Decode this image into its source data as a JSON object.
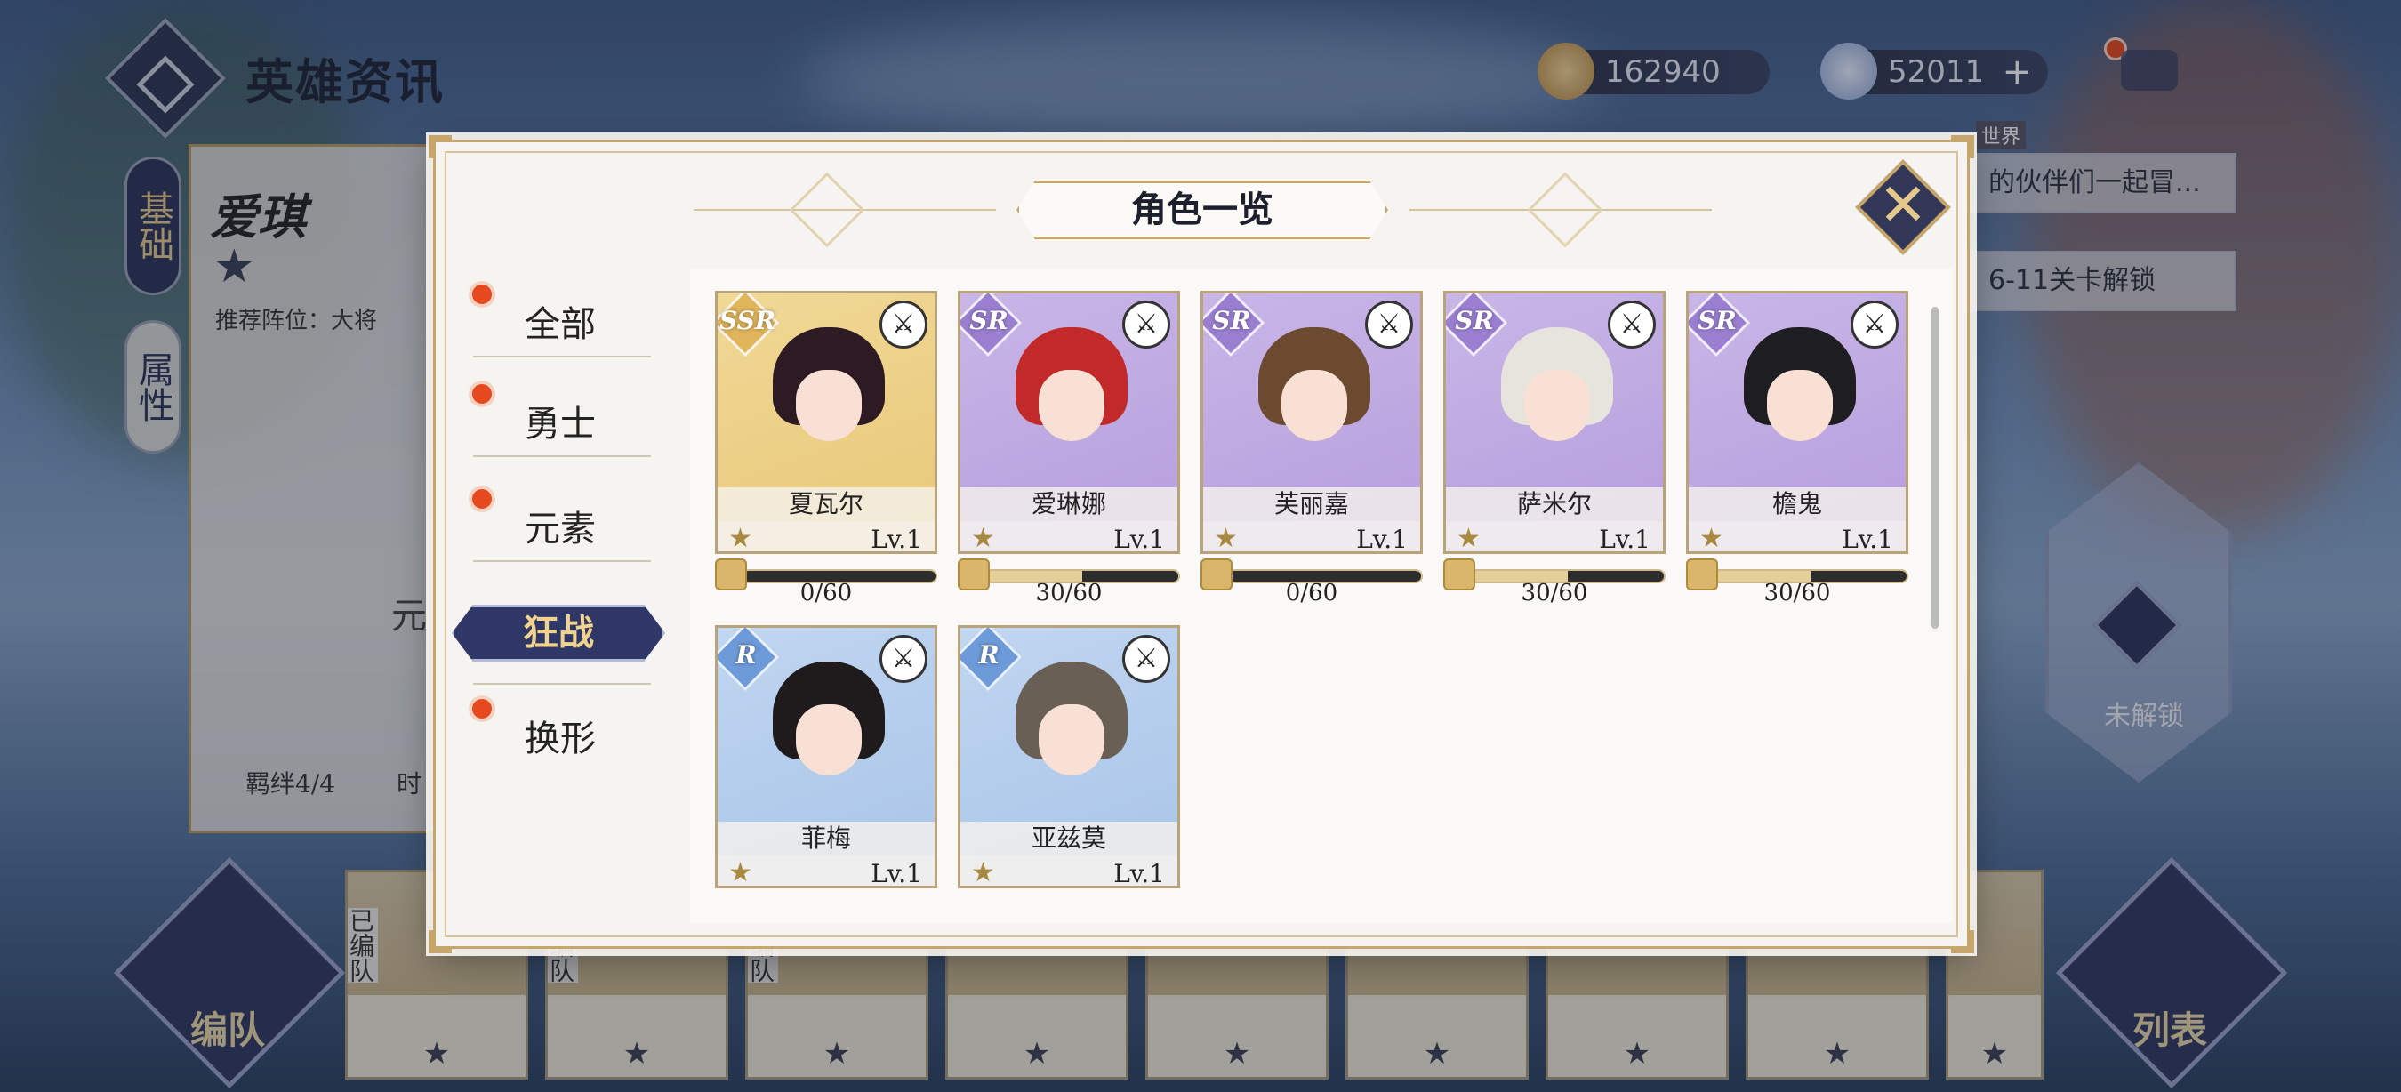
{
  "header": {
    "title": "英雄资讯",
    "gold": "162940",
    "gems": "52011",
    "gems_plus": "+"
  },
  "background": {
    "hero_name": "爱琪",
    "star": "★",
    "recommended": "推荐阵位：大将",
    "tab_basic": "基础",
    "tab_attr": "属性",
    "bond": "羁绊4/4",
    "element_partial": "元",
    "time_partial": "时",
    "chat_snippet": "的伙伴们一起冒...",
    "unlock_hint": "6-11关卡解锁",
    "world_tag": "世界",
    "lock_label": "未解锁",
    "formation_btn": "编队",
    "list_btn": "列表",
    "strip_tag": "已编队",
    "strip_star": "★"
  },
  "modal": {
    "title": "角色一览",
    "close_symbol": "✕",
    "categories": [
      {
        "label": "全部",
        "active": false,
        "has_dot": true
      },
      {
        "label": "勇士",
        "active": false,
        "has_dot": true
      },
      {
        "label": "元素",
        "active": false,
        "has_dot": true
      },
      {
        "label": "狂战",
        "active": true,
        "has_dot": false
      },
      {
        "label": "换形",
        "active": false,
        "has_dot": true
      }
    ],
    "heroes": [
      {
        "name": "夏瓦尔",
        "rarity": "SSR",
        "level": "Lv.1",
        "star": "★",
        "class_icon": "⚔",
        "shards": "0/60",
        "progress": 0
      },
      {
        "name": "爱琳娜",
        "rarity": "SR",
        "level": "Lv.1",
        "star": "★",
        "class_icon": "⚔",
        "shards": "30/60",
        "progress": 0.5
      },
      {
        "name": "芙丽嘉",
        "rarity": "SR",
        "level": "Lv.1",
        "star": "★",
        "class_icon": "⚔",
        "shards": "0/60",
        "progress": 0
      },
      {
        "name": "萨米尔",
        "rarity": "SR",
        "level": "Lv.1",
        "star": "★",
        "class_icon": "⚔",
        "shards": "30/60",
        "progress": 0.5
      },
      {
        "name": "檐鬼",
        "rarity": "SR",
        "level": "Lv.1",
        "star": "★",
        "class_icon": "⚔",
        "shards": "30/60",
        "progress": 0.5
      },
      {
        "name": "菲梅",
        "rarity": "R",
        "level": "Lv.1",
        "star": "★",
        "class_icon": "⚔"
      },
      {
        "name": "亚兹莫",
        "rarity": "R",
        "level": "Lv.1",
        "star": "★",
        "class_icon": "⚔"
      }
    ]
  },
  "colors": {
    "accent_gold": "#c7a66b",
    "active_tab": "#2f3766",
    "dot_red": "#e5491d",
    "ssr_bg": "#f0d896",
    "sr_bg": "#c9b6e7",
    "r_bg": "#c0d6f1"
  }
}
